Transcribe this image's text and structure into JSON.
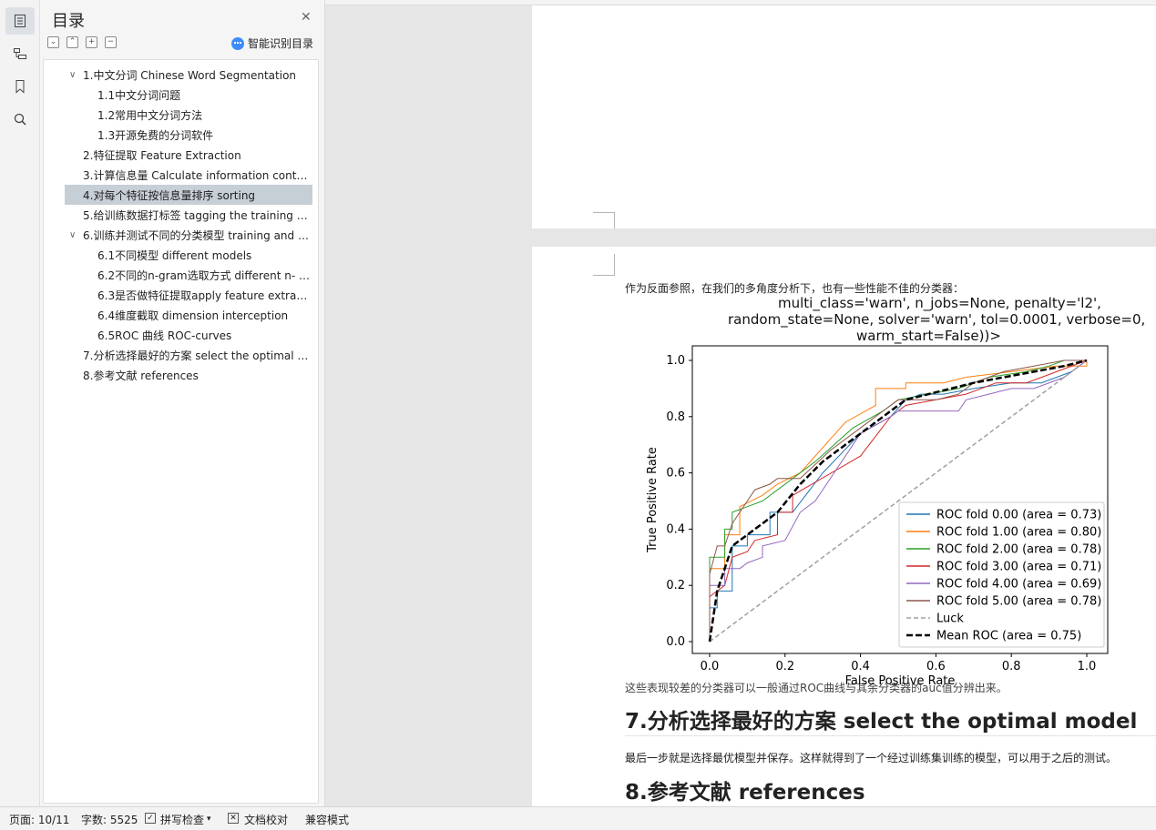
{
  "toc": {
    "title": "目录",
    "smart_label": "智能识别目录",
    "items": [
      {
        "label": "1.中文分词 Chinese Word Segmentation",
        "level": 1,
        "expanded": true
      },
      {
        "label": "1.1中文分词问题",
        "level": 2
      },
      {
        "label": "1.2常用中文分词方法",
        "level": 2
      },
      {
        "label": "1.3开源免费的分词软件",
        "level": 2
      },
      {
        "label": "2.特征提取 Feature Extraction",
        "level": 1
      },
      {
        "label": "3.计算信息量 Calculate information cont …",
        "level": 1
      },
      {
        "label": "4.对每个特征按信息量排序 sorting",
        "level": 1,
        "selected": true
      },
      {
        "label": "5.给训练数据打标签 tagging the training …",
        "level": 1
      },
      {
        "label": "6.训练并测试不同的分类模型 training and …",
        "level": 1,
        "expanded": true
      },
      {
        "label": "6.1不同模型 different models",
        "level": 2
      },
      {
        "label": "6.2不同的n-gram选取方式 different n- …",
        "level": 2
      },
      {
        "label": "6.3是否做特征提取apply feature extrac …",
        "level": 2
      },
      {
        "label": "6.4维度截取 dimension interception",
        "level": 2
      },
      {
        "label": "6.5ROC 曲线 ROC-curves",
        "level": 2
      },
      {
        "label": "7.分析选择最好的方案 select the optimal …",
        "level": 1
      },
      {
        "label": "8.参考文献 references",
        "level": 1
      }
    ]
  },
  "document": {
    "intro": "作为反面参照，在我们的多角度分析下，也有一些性能不佳的分类器：",
    "code_lines": [
      "multi_class='warn', n_jobs=None, penalty='l2',",
      "random_state=None, solver='warn', tol=0.0001, verbose=0,",
      "warm_start=False))>"
    ],
    "overlap_text": "这些表现较差的分类器可以一般通过ROC曲线与其余分类器的auc值分辨出来。",
    "heading7": "7.分析选择最好的方案 select the optimal model",
    "para7": "最后一步就是选择最优模型并保存。这样就得到了一个经过训练集训练的模型，可以用于之后的测试。",
    "heading8": "8.参考文献 references"
  },
  "chart_data": {
    "type": "line",
    "xlabel": "False Positive Rate",
    "ylabel": "True Positive Rate",
    "xlim": [
      0.0,
      1.0
    ],
    "ylim": [
      0.0,
      1.0
    ],
    "xticks": [
      "0.0",
      "0.2",
      "0.4",
      "0.6",
      "0.8",
      "1.0"
    ],
    "yticks": [
      "0.0",
      "0.2",
      "0.4",
      "0.6",
      "0.8",
      "1.0"
    ],
    "legend_position": "lower-right",
    "grid": false,
    "series": [
      {
        "name": "ROC fold 0.00 (area = 0.73)",
        "color": "#1f77b4",
        "style": "solid",
        "points": [
          [
            0,
            0
          ],
          [
            0,
            0.12
          ],
          [
            0.02,
            0.12
          ],
          [
            0.02,
            0.18
          ],
          [
            0.06,
            0.18
          ],
          [
            0.06,
            0.34
          ],
          [
            0.1,
            0.34
          ],
          [
            0.1,
            0.38
          ],
          [
            0.16,
            0.38
          ],
          [
            0.16,
            0.46
          ],
          [
            0.22,
            0.46
          ],
          [
            0.3,
            0.6
          ],
          [
            0.4,
            0.74
          ],
          [
            0.48,
            0.8
          ],
          [
            0.52,
            0.86
          ],
          [
            0.56,
            0.88
          ],
          [
            0.62,
            0.88
          ],
          [
            0.7,
            0.9
          ],
          [
            0.8,
            0.92
          ],
          [
            0.88,
            0.92
          ],
          [
            0.96,
            0.96
          ],
          [
            1,
            1
          ]
        ]
      },
      {
        "name": "ROC fold 1.00 (area = 0.80)",
        "color": "#ff7f0e",
        "style": "solid",
        "points": [
          [
            0,
            0
          ],
          [
            0,
            0.26
          ],
          [
            0.04,
            0.26
          ],
          [
            0.04,
            0.38
          ],
          [
            0.08,
            0.38
          ],
          [
            0.08,
            0.48
          ],
          [
            0.14,
            0.52
          ],
          [
            0.18,
            0.56
          ],
          [
            0.24,
            0.6
          ],
          [
            0.36,
            0.78
          ],
          [
            0.44,
            0.84
          ],
          [
            0.44,
            0.9
          ],
          [
            0.52,
            0.9
          ],
          [
            0.52,
            0.92
          ],
          [
            0.62,
            0.92
          ],
          [
            0.68,
            0.94
          ],
          [
            0.8,
            0.96
          ],
          [
            0.92,
            0.98
          ],
          [
            1,
            0.98
          ],
          [
            1,
            1
          ]
        ]
      },
      {
        "name": "ROC fold 2.00 (area = 0.78)",
        "color": "#2ca02c",
        "style": "solid",
        "points": [
          [
            0,
            0
          ],
          [
            0,
            0.3
          ],
          [
            0.04,
            0.3
          ],
          [
            0.04,
            0.4
          ],
          [
            0.06,
            0.4
          ],
          [
            0.06,
            0.46
          ],
          [
            0.1,
            0.48
          ],
          [
            0.14,
            0.5
          ],
          [
            0.22,
            0.58
          ],
          [
            0.28,
            0.64
          ],
          [
            0.38,
            0.76
          ],
          [
            0.46,
            0.82
          ],
          [
            0.5,
            0.86
          ],
          [
            0.58,
            0.88
          ],
          [
            0.66,
            0.9
          ],
          [
            0.74,
            0.94
          ],
          [
            0.84,
            0.96
          ],
          [
            0.9,
            0.98
          ],
          [
            0.94,
            1
          ],
          [
            1,
            1
          ]
        ]
      },
      {
        "name": "ROC fold 3.00 (area = 0.71)",
        "color": "#d62728",
        "style": "solid",
        "points": [
          [
            0,
            0
          ],
          [
            0,
            0.16
          ],
          [
            0.04,
            0.2
          ],
          [
            0.06,
            0.3
          ],
          [
            0.1,
            0.32
          ],
          [
            0.12,
            0.36
          ],
          [
            0.18,
            0.38
          ],
          [
            0.18,
            0.46
          ],
          [
            0.22,
            0.46
          ],
          [
            0.22,
            0.52
          ],
          [
            0.4,
            0.66
          ],
          [
            0.48,
            0.8
          ],
          [
            0.52,
            0.84
          ],
          [
            0.6,
            0.86
          ],
          [
            0.68,
            0.88
          ],
          [
            0.76,
            0.92
          ],
          [
            0.84,
            0.92
          ],
          [
            0.92,
            0.96
          ],
          [
            1,
            1
          ]
        ]
      },
      {
        "name": "ROC fold 4.00 (area = 0.69)",
        "color": "#9467bd",
        "style": "solid",
        "points": [
          [
            0,
            0
          ],
          [
            0,
            0.2
          ],
          [
            0.04,
            0.2
          ],
          [
            0.04,
            0.26
          ],
          [
            0.08,
            0.26
          ],
          [
            0.1,
            0.28
          ],
          [
            0.14,
            0.3
          ],
          [
            0.14,
            0.34
          ],
          [
            0.2,
            0.36
          ],
          [
            0.24,
            0.46
          ],
          [
            0.28,
            0.5
          ],
          [
            0.34,
            0.62
          ],
          [
            0.4,
            0.74
          ],
          [
            0.48,
            0.8
          ],
          [
            0.5,
            0.82
          ],
          [
            0.56,
            0.82
          ],
          [
            0.6,
            0.82
          ],
          [
            0.66,
            0.82
          ],
          [
            0.68,
            0.86
          ],
          [
            0.74,
            0.88
          ],
          [
            0.8,
            0.9
          ],
          [
            0.86,
            0.9
          ],
          [
            0.94,
            0.94
          ],
          [
            0.98,
            0.98
          ],
          [
            1,
            1
          ]
        ]
      },
      {
        "name": "ROC fold 5.00 (area = 0.78)",
        "color": "#8c564b",
        "style": "solid",
        "points": [
          [
            0,
            0
          ],
          [
            0,
            0.24
          ],
          [
            0.02,
            0.34
          ],
          [
            0.04,
            0.34
          ],
          [
            0.06,
            0.42
          ],
          [
            0.08,
            0.46
          ],
          [
            0.1,
            0.5
          ],
          [
            0.12,
            0.54
          ],
          [
            0.16,
            0.56
          ],
          [
            0.18,
            0.58
          ],
          [
            0.24,
            0.58
          ],
          [
            0.32,
            0.68
          ],
          [
            0.4,
            0.76
          ],
          [
            0.46,
            0.82
          ],
          [
            0.5,
            0.86
          ],
          [
            0.6,
            0.86
          ],
          [
            0.66,
            0.88
          ],
          [
            0.7,
            0.92
          ],
          [
            0.78,
            0.96
          ],
          [
            0.86,
            0.98
          ],
          [
            0.94,
            1
          ],
          [
            1,
            1
          ]
        ]
      },
      {
        "name": "Luck",
        "color": "#a0a0a0",
        "style": "dashed",
        "points": [
          [
            0,
            0
          ],
          [
            1,
            1
          ]
        ]
      },
      {
        "name": "Mean ROC (area = 0.75)",
        "color": "#000000",
        "style": "mean",
        "points": [
          [
            0,
            0
          ],
          [
            0.02,
            0.18
          ],
          [
            0.04,
            0.26
          ],
          [
            0.06,
            0.34
          ],
          [
            0.1,
            0.38
          ],
          [
            0.14,
            0.42
          ],
          [
            0.18,
            0.46
          ],
          [
            0.24,
            0.56
          ],
          [
            0.3,
            0.64
          ],
          [
            0.36,
            0.7
          ],
          [
            0.42,
            0.76
          ],
          [
            0.48,
            0.82
          ],
          [
            0.52,
            0.86
          ],
          [
            0.58,
            0.88
          ],
          [
            0.64,
            0.9
          ],
          [
            0.7,
            0.92
          ],
          [
            0.78,
            0.94
          ],
          [
            0.86,
            0.96
          ],
          [
            0.94,
            0.98
          ],
          [
            1,
            1
          ]
        ]
      }
    ]
  },
  "status": {
    "page": "页面: 10/11",
    "words": "字数: 5525",
    "spell": "拼写检查",
    "proof": "文档校对",
    "compat": "兼容模式"
  }
}
